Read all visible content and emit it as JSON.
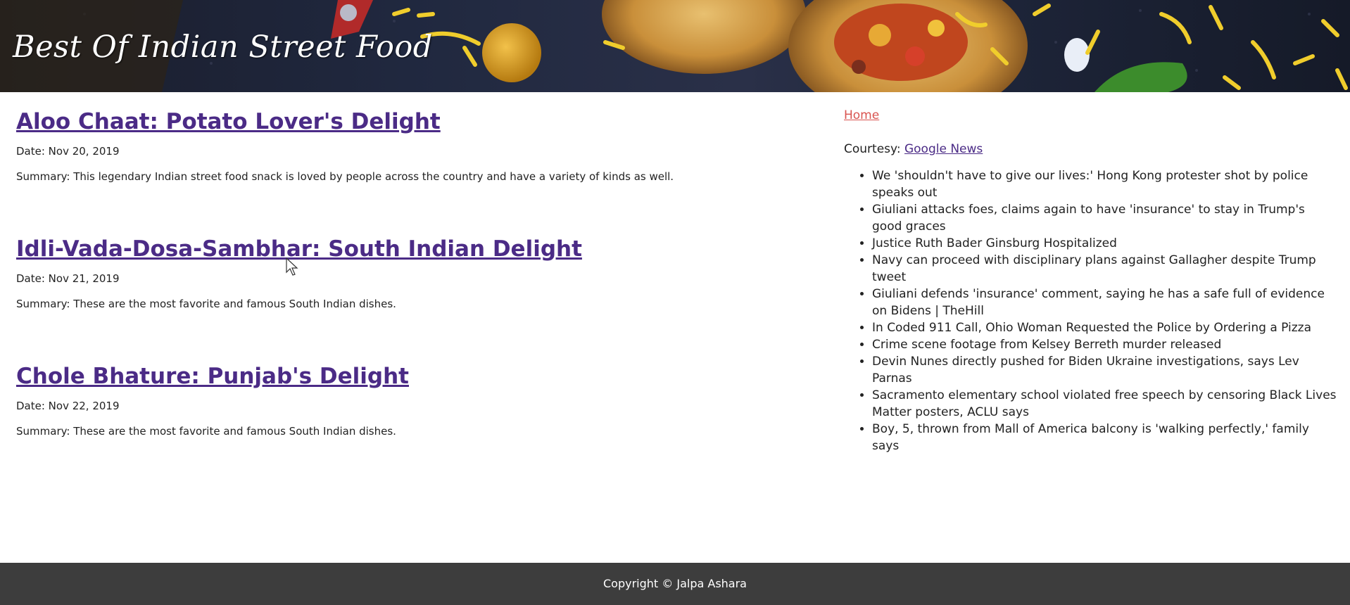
{
  "header": {
    "site_title": "Best Of Indian Street Food"
  },
  "articles": [
    {
      "title": "Aloo Chaat: Potato Lover's Delight",
      "date": "Date: Nov 20, 2019",
      "summary": "Summary: This legendary Indian street food snack is loved by people across the country and have a variety of kinds as well."
    },
    {
      "title": "Idli-Vada-Dosa-Sambhar: South Indian Delight",
      "date": "Date: Nov 21, 2019",
      "summary": "Summary: These are the most favorite and famous South Indian dishes."
    },
    {
      "title": "Chole Bhature: Punjab's Delight",
      "date": "Date: Nov 22, 2019",
      "summary": "Summary: These are the most favorite and famous South Indian dishes."
    }
  ],
  "sidebar": {
    "home_label": "Home",
    "courtesy_label": "Courtesy:",
    "courtesy_link": "Google News",
    "news": [
      "We 'shouldn't have to give our lives:' Hong Kong protester shot by police speaks out",
      "Giuliani attacks foes, claims again to have 'insurance' to stay in Trump's good graces",
      "Justice Ruth Bader Ginsburg Hospitalized",
      "Navy can proceed with disciplinary plans against Gallagher despite Trump tweet",
      "Giuliani defends 'insurance' comment, saying he has a safe full of evidence on Bidens | TheHill",
      "In Coded 911 Call, Ohio Woman Requested the Police by Ordering a Pizza",
      "Crime scene footage from Kelsey Berreth murder released",
      "Devin Nunes directly pushed for Biden Ukraine investigations, says Lev Parnas",
      "Sacramento elementary school violated free speech by censoring Black Lives Matter posters, ACLU says",
      "Boy, 5, thrown from Mall of America balcony is 'walking perfectly,' family says"
    ]
  },
  "footer": {
    "copyright": "Copyright © Jalpa Ashara"
  },
  "colors": {
    "visited_link": "#4b2b86",
    "home_link": "#d9534f",
    "footer_bg": "#3d3d3d"
  }
}
